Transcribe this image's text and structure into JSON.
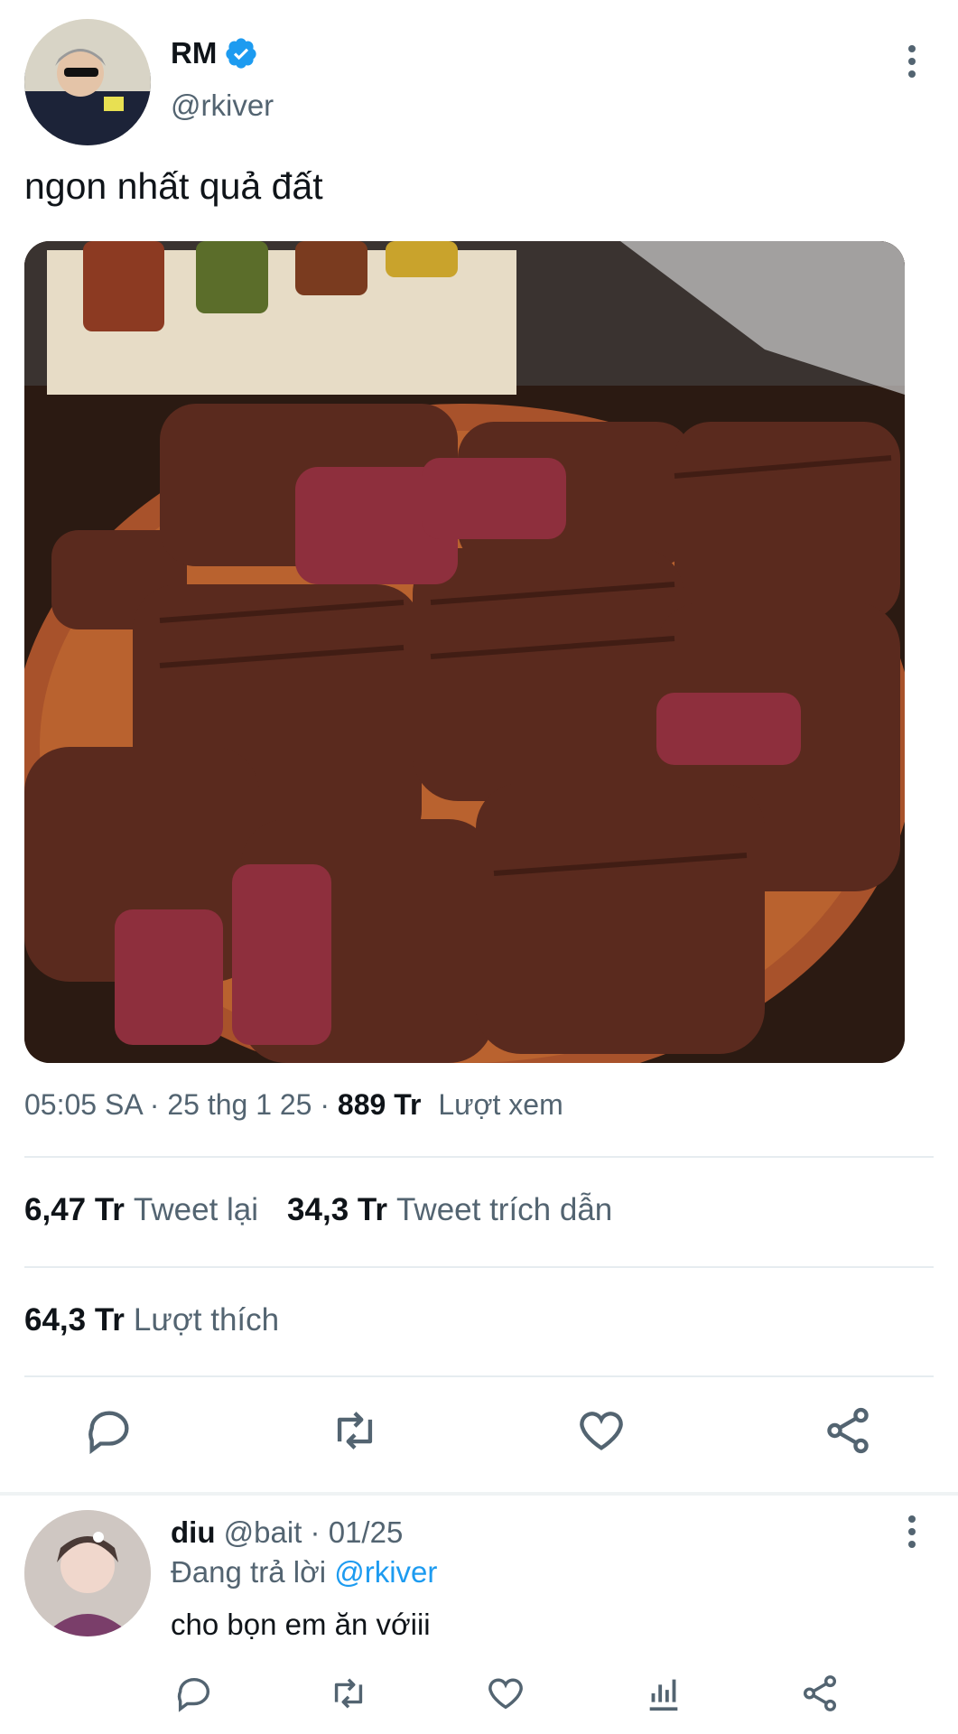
{
  "tweet": {
    "author_name": "RM",
    "author_handle": "@rkiver",
    "verified_color": "#1d9bf0",
    "text": "ngon nhất quả đất",
    "media_icon": "steak-photo",
    "time": "05:05 SA",
    "date": "25 thg 1 25",
    "views_count": "889 Tr",
    "views_label": "Lượt xem",
    "retweets_count": "6,47 Tr",
    "retweets_label": "Tweet lại",
    "quotes_count": "34,3 Tr",
    "quotes_label": "Tweet trích dẫn",
    "likes_count": "64,3 Tr",
    "likes_label": "Lượt thích",
    "actions": [
      "reply-icon",
      "retweet-icon",
      "like-icon",
      "share-icon"
    ]
  },
  "reply": {
    "author_name": "diu",
    "author_handle": "@bait",
    "date": "01/25",
    "replying_prefix": "Đang trả lời",
    "replying_to": "@rkiver",
    "text": "cho bọn em ăn vớiii",
    "actions": [
      "reply-icon",
      "retweet-icon",
      "like-icon",
      "analytics-icon",
      "share-icon"
    ]
  },
  "colors": {
    "text": "#0f1419",
    "secondary": "#536471",
    "link": "#1d9bf0",
    "divider": "#e6ecf0"
  }
}
